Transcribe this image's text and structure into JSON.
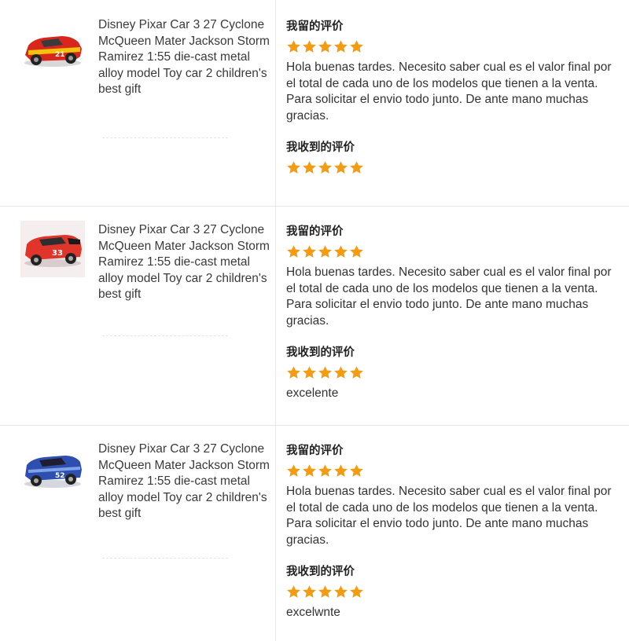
{
  "accent_colors": {
    "star": "#f39c12"
  },
  "reviews": [
    {
      "product_title": "Disney Pixar Car 3 27 Cyclone McQueen Mater Jackson Storm Ramirez 1:55 die-cast metal alloy model Toy car 2 children's best gift",
      "thumbnail_icon": "red-yellow-race-car-icon",
      "left_label": "我留的评价",
      "left_rating": 5,
      "left_text": "Hola buenas tardes. Necesito saber cual es el valor final por el total de cada uno de los modelos que tienen a la venta. Para solicitar el envio todo junto. De ante mano muchas gracias.",
      "received_label": "我收到的评价",
      "received_rating": 5,
      "received_text": ""
    },
    {
      "product_title": "Disney Pixar Car 3 27 Cyclone McQueen Mater Jackson Storm Ramirez 1:55 die-cast metal alloy model Toy car 2 children's best gift",
      "thumbnail_icon": "red-race-car-icon",
      "left_label": "我留的评价",
      "left_rating": 5,
      "left_text": "Hola buenas tardes. Necesito saber cual es el valor final por el total de cada uno de los modelos que tienen a la venta. Para solicitar el envio todo junto. De ante mano muchas gracias.",
      "received_label": "我收到的评价",
      "received_rating": 5,
      "received_text": "excelente"
    },
    {
      "product_title": "Disney Pixar Car 3 27 Cyclone McQueen Mater Jackson Storm Ramirez 1:55 die-cast metal alloy model Toy car 2 children's best gift",
      "thumbnail_icon": "blue-race-car-icon",
      "left_label": "我留的评价",
      "left_rating": 5,
      "left_text": "Hola buenas tardes. Necesito saber cual es el valor final por el total de cada uno de los modelos que tienen a la venta. Para solicitar el envio todo junto. De ante mano muchas gracias.",
      "received_label": "我收到的评价",
      "received_rating": 5,
      "received_text": "excelwnte"
    }
  ]
}
